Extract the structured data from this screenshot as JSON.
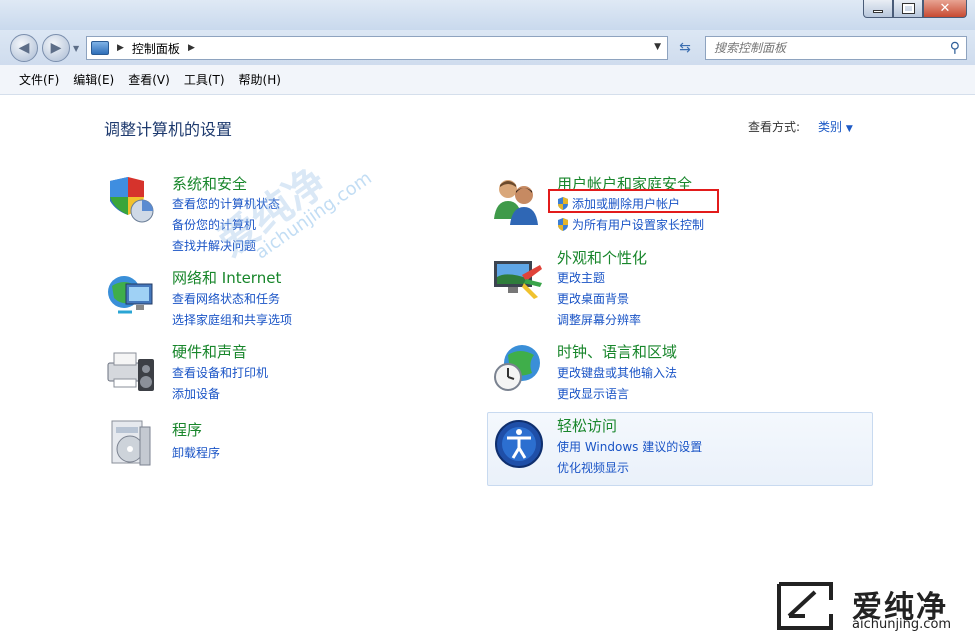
{
  "address": {
    "path": "控制面板",
    "search_placeholder": "搜索控制面板"
  },
  "menu": [
    "文件(F)",
    "编辑(E)",
    "查看(V)",
    "工具(T)",
    "帮助(H)"
  ],
  "main": {
    "heading": "调整计算机的设置",
    "view_by_label": "查看方式:",
    "view_by_value": "类别"
  },
  "categories_left": [
    {
      "title": "系统和安全",
      "links": [
        "查看您的计算机状态",
        "备份您的计算机",
        "查找并解决问题"
      ]
    },
    {
      "title": "网络和 Internet",
      "links": [
        "查看网络状态和任务",
        "选择家庭组和共享选项"
      ]
    },
    {
      "title": "硬件和声音",
      "links": [
        "查看设备和打印机",
        "添加设备"
      ]
    },
    {
      "title": "程序",
      "links": [
        "卸载程序"
      ]
    }
  ],
  "categories_right": [
    {
      "title": "用户帐户和家庭安全",
      "links": [
        "添加或删除用户帐户",
        "为所有用户设置家长控制"
      ]
    },
    {
      "title": "外观和个性化",
      "links": [
        "更改主题",
        "更改桌面背景",
        "调整屏幕分辨率"
      ]
    },
    {
      "title": "时钟、语言和区域",
      "links": [
        "更改键盘或其他输入法",
        "更改显示语言"
      ]
    },
    {
      "title": "轻松访问",
      "links": [
        "使用 Windows 建议的设置",
        "优化视频显示"
      ]
    }
  ],
  "watermark": {
    "brand": "爱纯净",
    "url": "aichunjing.com"
  },
  "colors": {
    "category_title": "#18862b",
    "link": "#1a54c6",
    "highlight_box": "#e21b1b"
  }
}
